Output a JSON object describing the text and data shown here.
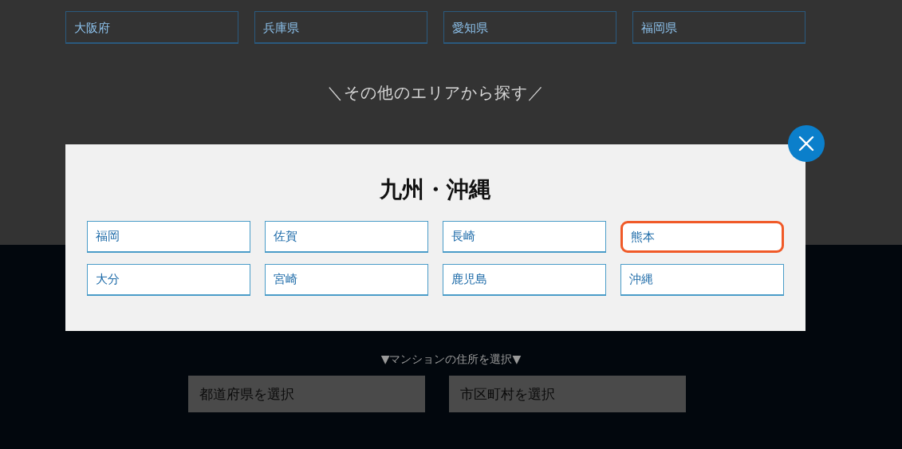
{
  "page": {
    "prefectures": [
      {
        "label": "大阪府"
      },
      {
        "label": "兵庫県"
      },
      {
        "label": "愛知県"
      },
      {
        "label": "福岡県"
      }
    ],
    "other_areas_heading": "＼その他のエリアから探す／",
    "address_prompt": "▼マンションの住所を選択▼",
    "selects": [
      {
        "placeholder": "都道府県を選択"
      },
      {
        "placeholder": "市区町村を選択"
      }
    ]
  },
  "modal": {
    "title": "九州・沖縄",
    "options": [
      {
        "label": "福岡",
        "selected": false
      },
      {
        "label": "佐賀",
        "selected": false
      },
      {
        "label": "長崎",
        "selected": false
      },
      {
        "label": "熊本",
        "selected": true
      },
      {
        "label": "大分",
        "selected": false
      },
      {
        "label": "宮崎",
        "selected": false
      },
      {
        "label": "鹿児島",
        "selected": false
      },
      {
        "label": "沖縄",
        "selected": false
      }
    ]
  }
}
